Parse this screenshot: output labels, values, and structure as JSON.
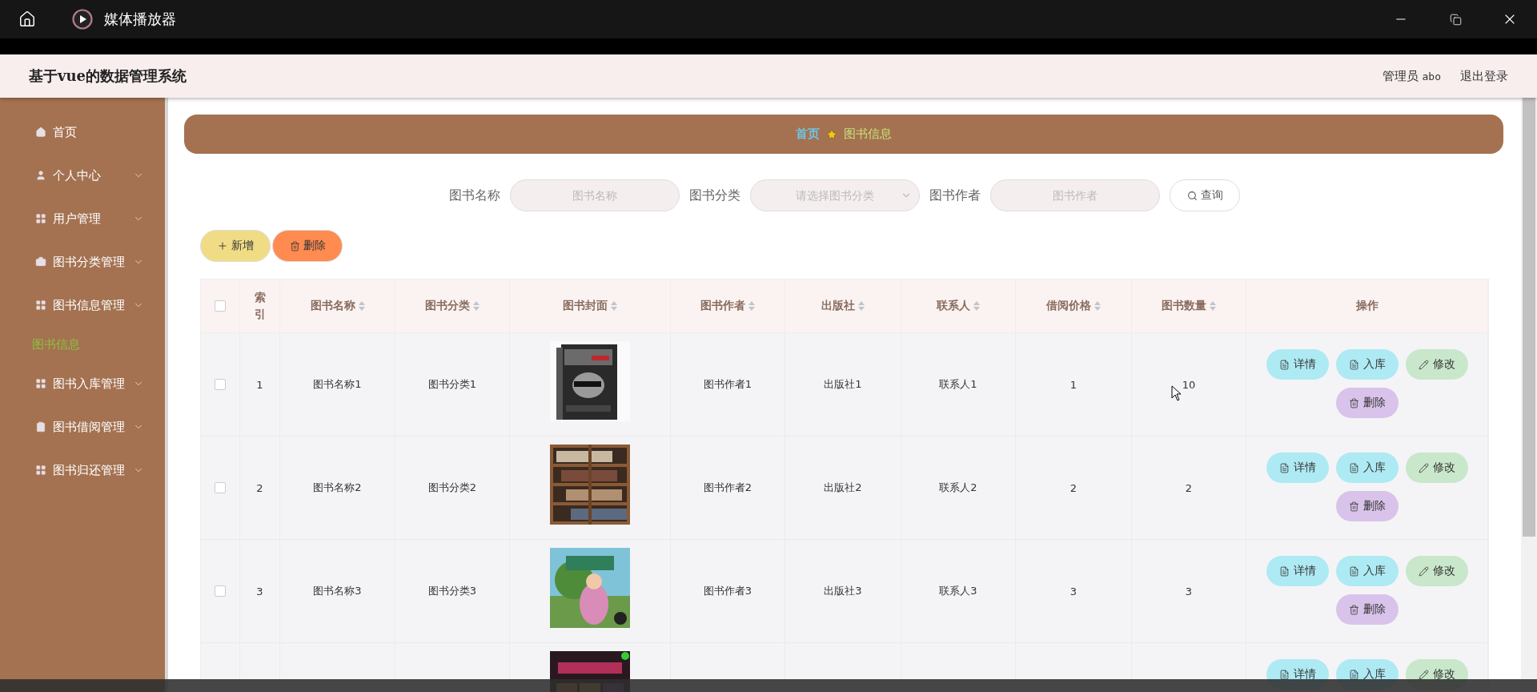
{
  "window": {
    "title": "媒体播放器"
  },
  "app": {
    "title": "基于vue的数据管理系统",
    "user_role": "管理员",
    "user_name": "abo",
    "logout": "退出登录"
  },
  "sidebar": {
    "items": [
      {
        "label": "首页",
        "kind": "home",
        "expandable": false
      },
      {
        "label": "个人中心",
        "kind": "user",
        "expandable": true
      },
      {
        "label": "用户管理",
        "kind": "grid",
        "expandable": true
      },
      {
        "label": "图书分类管理",
        "kind": "briefcase",
        "expandable": true
      },
      {
        "label": "图书信息管理",
        "kind": "grid",
        "expandable": true,
        "children": [
          {
            "label": "图书信息",
            "selected": true
          }
        ]
      },
      {
        "label": "图书入库管理",
        "kind": "grid",
        "expandable": true
      },
      {
        "label": "图书借阅管理",
        "kind": "clipboard",
        "expandable": true
      },
      {
        "label": "图书归还管理",
        "kind": "grid",
        "expandable": true
      }
    ]
  },
  "breadcrumb": [
    "首页",
    "图书信息"
  ],
  "search": {
    "fields": [
      {
        "label": "图书名称",
        "placeholder": "图书名称",
        "kind": "text"
      },
      {
        "label": "图书分类",
        "placeholder": "请选择图书分类",
        "kind": "select"
      },
      {
        "label": "图书作者",
        "placeholder": "图书作者",
        "kind": "text"
      }
    ],
    "button": "查询"
  },
  "toolbar": [
    {
      "label": "新增",
      "kind": "add"
    },
    {
      "label": "删除",
      "kind": "delete"
    }
  ],
  "table": {
    "select_all": {
      "checked": false
    },
    "columns": [
      {
        "label": "索引",
        "sortable": false
      },
      {
        "label": "图书名称",
        "sortable": true
      },
      {
        "label": "图书分类",
        "sortable": true
      },
      {
        "label": "图书封面",
        "sortable": true
      },
      {
        "label": "图书作者",
        "sortable": true
      },
      {
        "label": "出版社",
        "sortable": true
      },
      {
        "label": "联系人",
        "sortable": true
      },
      {
        "label": "借阅价格",
        "sortable": true
      },
      {
        "label": "图书数量",
        "sortable": true
      },
      {
        "label": "操作",
        "sortable": false
      }
    ],
    "rows": [
      {
        "checked": false,
        "cells": [
          "1",
          "图书名称1",
          "图书分类1",
          null,
          "图书作者1",
          "出版社1",
          "联系人1",
          "1",
          "10"
        ],
        "cover": {
          "kind": "picture"
        },
        "actions": [
          {
            "label": "详情",
            "kind": "info"
          },
          {
            "label": "入库",
            "kind": "info"
          },
          {
            "label": "修改",
            "kind": "edit"
          },
          {
            "label": "删除",
            "kind": "delete"
          }
        ]
      },
      {
        "checked": false,
        "cells": [
          "2",
          "图书名称2",
          "图书分类2",
          null,
          "图书作者2",
          "出版社2",
          "联系人2",
          "2",
          "2"
        ],
        "cover": {
          "kind": "picture"
        },
        "actions": [
          {
            "label": "详情",
            "kind": "info"
          },
          {
            "label": "入库",
            "kind": "info"
          },
          {
            "label": "修改",
            "kind": "edit"
          },
          {
            "label": "删除",
            "kind": "delete"
          }
        ]
      },
      {
        "checked": false,
        "cells": [
          "3",
          "图书名称3",
          "图书分类3",
          null,
          "图书作者3",
          "出版社3",
          "联系人3",
          "3",
          "3"
        ],
        "cover": {
          "kind": "picture"
        },
        "actions": [
          {
            "label": "详情",
            "kind": "info"
          },
          {
            "label": "入库",
            "kind": "info"
          },
          {
            "label": "修改",
            "kind": "edit"
          },
          {
            "label": "删除",
            "kind": "delete"
          }
        ]
      }
    ],
    "partial_row": {
      "cover": {
        "kind": "picture"
      },
      "actions": [
        {
          "label": "详情",
          "kind": "info"
        },
        {
          "label": "入库",
          "kind": "info"
        },
        {
          "label": "修改",
          "kind": "edit"
        }
      ]
    }
  }
}
